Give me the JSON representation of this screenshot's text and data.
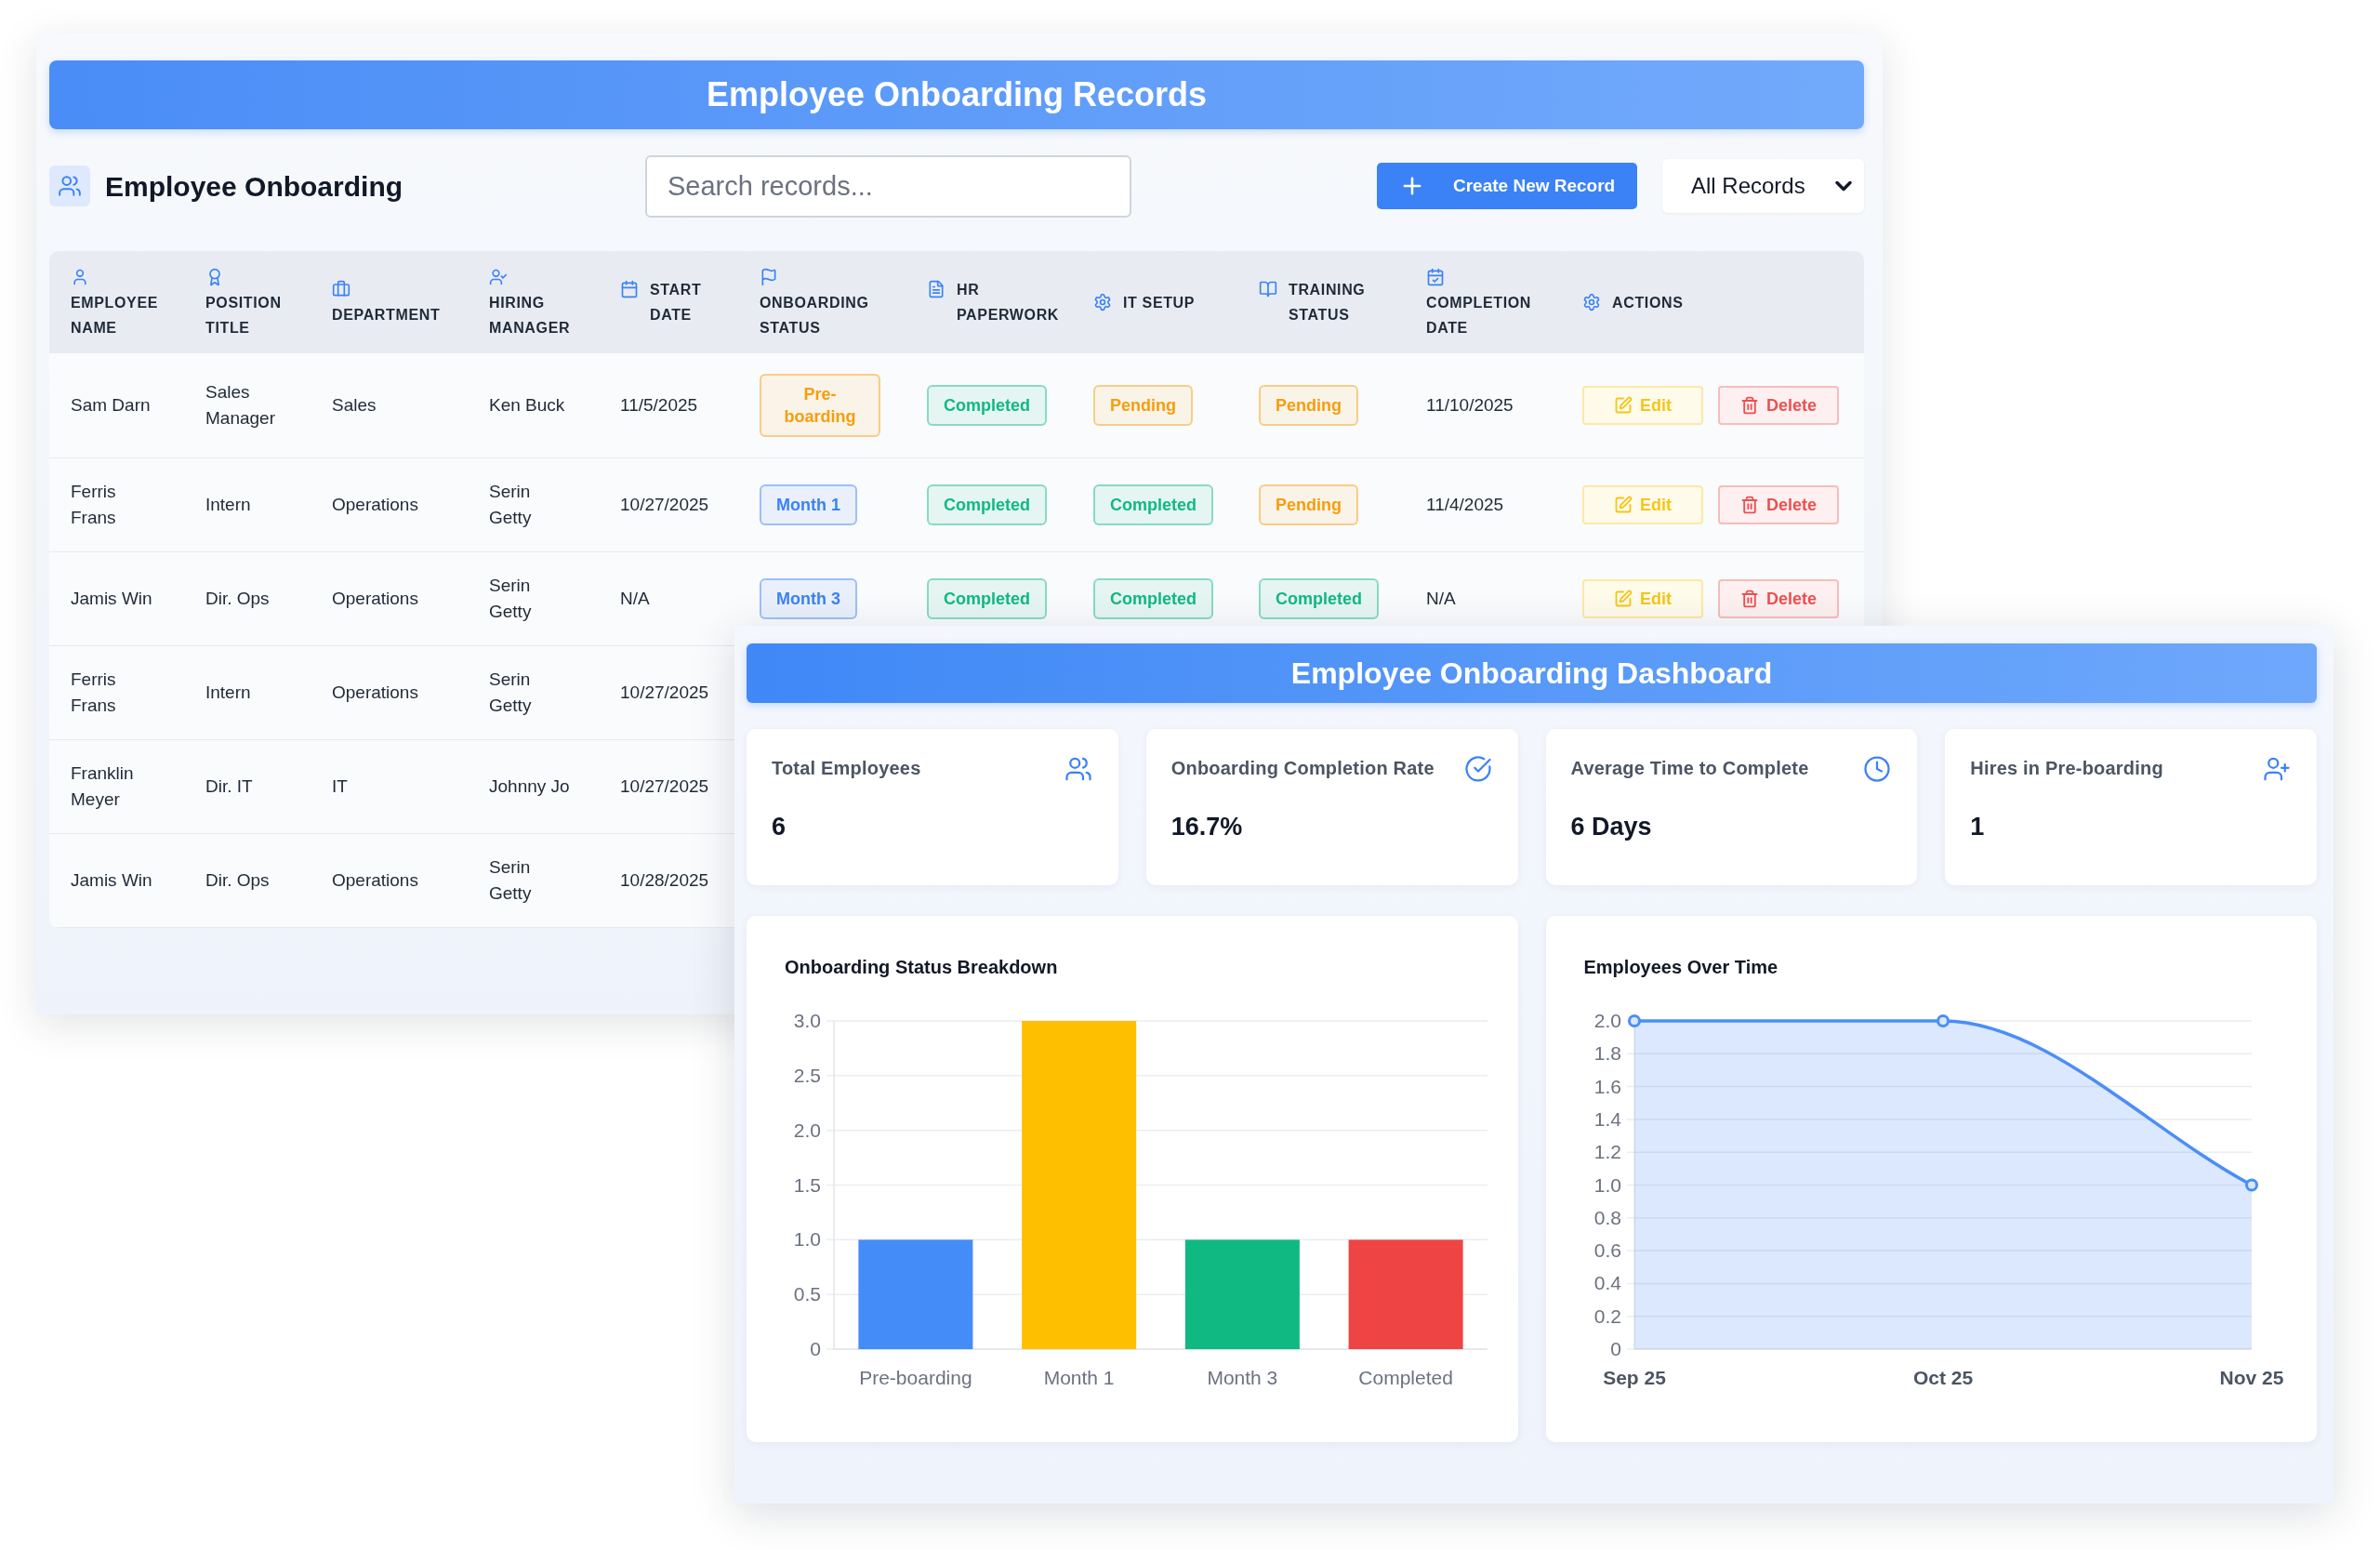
{
  "records_window": {
    "title": "Employee Onboarding Records",
    "heading": "Employee Onboarding",
    "search": {
      "placeholder": "Search records..."
    },
    "create_button": {
      "label": "Create New Record"
    },
    "filter": {
      "value": "All Records"
    },
    "table": {
      "columns": [
        {
          "label": "EMPLOYEE NAME"
        },
        {
          "label": "POSITION TITLE"
        },
        {
          "label": "DEPARTMENT"
        },
        {
          "label": "HIRING MANAGER"
        },
        {
          "label": "START DATE"
        },
        {
          "label": "ONBOARDING STATUS"
        },
        {
          "label": "HR PAPERWORK"
        },
        {
          "label": "IT SETUP"
        },
        {
          "label": "TRAINING STATUS"
        },
        {
          "label": "COMPLETION DATE"
        },
        {
          "label": "ACTIONS"
        }
      ],
      "rows": [
        {
          "cells": [
            {
              "kind": "text",
              "text": "Sam Darn"
            },
            {
              "kind": "text",
              "text": "Sales Manager"
            },
            {
              "kind": "text",
              "text": "Sales"
            },
            {
              "kind": "text",
              "text": "Ken Buck"
            },
            {
              "kind": "text",
              "text": "11/5/2025"
            },
            {
              "kind": "badge",
              "text": "Pre-boarding",
              "color": "#f59e0b"
            },
            {
              "kind": "badge",
              "text": "Completed",
              "color": "#10b981"
            },
            {
              "kind": "badge",
              "text": "Pending",
              "color": "#f59e0b"
            },
            {
              "kind": "badge",
              "text": "Pending",
              "color": "#f59e0b"
            },
            {
              "kind": "text",
              "text": "11/10/2025"
            },
            {
              "kind": "actions",
              "buttons": [
                {
                  "kind": "edit",
                  "label": "Edit"
                },
                {
                  "kind": "delete",
                  "label": "Delete"
                }
              ]
            }
          ]
        },
        {
          "cells": [
            {
              "kind": "text",
              "text": "Ferris Frans"
            },
            {
              "kind": "text",
              "text": "Intern"
            },
            {
              "kind": "text",
              "text": "Operations"
            },
            {
              "kind": "text",
              "text": "Serin Getty"
            },
            {
              "kind": "text",
              "text": "10/27/2025"
            },
            {
              "kind": "badge",
              "text": "Month 1",
              "color": "#3b82f6"
            },
            {
              "kind": "badge",
              "text": "Completed",
              "color": "#10b981"
            },
            {
              "kind": "badge",
              "text": "Completed",
              "color": "#10b981"
            },
            {
              "kind": "badge",
              "text": "Pending",
              "color": "#f59e0b"
            },
            {
              "kind": "text",
              "text": "11/4/2025"
            },
            {
              "kind": "actions",
              "buttons": [
                {
                  "kind": "edit",
                  "label": "Edit"
                },
                {
                  "kind": "delete",
                  "label": "Delete"
                }
              ]
            }
          ]
        },
        {
          "cells": [
            {
              "kind": "text",
              "text": "Jamis Win"
            },
            {
              "kind": "text",
              "text": "Dir. Ops"
            },
            {
              "kind": "text",
              "text": "Operations"
            },
            {
              "kind": "text",
              "text": "Serin Getty"
            },
            {
              "kind": "text",
              "text": "N/A"
            },
            {
              "kind": "badge",
              "text": "Month 3",
              "color": "#3b82f6"
            },
            {
              "kind": "badge",
              "text": "Completed",
              "color": "#10b981"
            },
            {
              "kind": "badge",
              "text": "Completed",
              "color": "#10b981"
            },
            {
              "kind": "badge",
              "text": "Completed",
              "color": "#10b981"
            },
            {
              "kind": "text",
              "text": "N/A"
            },
            {
              "kind": "actions",
              "buttons": [
                {
                  "kind": "edit",
                  "label": "Edit"
                },
                {
                  "kind": "delete",
                  "label": "Delete"
                }
              ]
            }
          ]
        },
        {
          "cells": [
            {
              "kind": "text",
              "text": "Ferris Frans"
            },
            {
              "kind": "text",
              "text": "Intern"
            },
            {
              "kind": "text",
              "text": "Operations"
            },
            {
              "kind": "text",
              "text": "Serin Getty"
            },
            {
              "kind": "text",
              "text": "10/27/2025"
            }
          ]
        },
        {
          "cells": [
            {
              "kind": "text",
              "text": "Franklin Meyer"
            },
            {
              "kind": "text",
              "text": "Dir. IT"
            },
            {
              "kind": "text",
              "text": "IT"
            },
            {
              "kind": "text",
              "text": "Johnny Jo"
            },
            {
              "kind": "text",
              "text": "10/27/2025"
            }
          ]
        },
        {
          "cells": [
            {
              "kind": "text",
              "text": "Jamis Win"
            },
            {
              "kind": "text",
              "text": "Dir. Ops"
            },
            {
              "kind": "text",
              "text": "Operations"
            },
            {
              "kind": "text",
              "text": "Serin Getty"
            },
            {
              "kind": "text",
              "text": "10/28/2025"
            }
          ]
        }
      ]
    }
  },
  "dashboard_window": {
    "title": "Employee Onboarding Dashboard",
    "stats": [
      {
        "label": "Total Employees",
        "value": "6"
      },
      {
        "label": "Onboarding Completion Rate",
        "value": "16.7%"
      },
      {
        "label": "Average Time to Complete",
        "value": "6 Days"
      },
      {
        "label": "Hires in Pre-boarding",
        "value": "1"
      }
    ],
    "charts": [
      {
        "chart_data": {
          "type": "bar",
          "title": "Onboarding Status Breakdown",
          "categories": [
            "Pre-boarding",
            "Month 1",
            "Month 3",
            "Completed"
          ],
          "values": [
            1,
            3,
            1,
            1
          ],
          "colors": [
            "#448cf8",
            "#fdbf00",
            "#10b981",
            "#ef4444"
          ],
          "ylim": [
            0,
            3
          ],
          "yticks": [
            0,
            0.5,
            {
              "value": 1,
              "label": "1.0"
            },
            1.5,
            {
              "value": 2,
              "label": "2.0"
            },
            2.5,
            {
              "value": 3,
              "label": "3.0"
            }
          ],
          "grid": true
        }
      },
      {
        "chart_data": {
          "type": "line",
          "title": "Employees Over Time",
          "categories": [
            "Sep 25",
            "Oct 25",
            "Nov 25"
          ],
          "series": [
            {
              "color": "#4a8ef8",
              "values": [
                2,
                2,
                1
              ],
              "marker": "circle"
            }
          ],
          "ylim": [
            0,
            2
          ],
          "yticks": [
            0,
            0.2,
            0.4,
            0.6,
            0.8,
            {
              "value": 1,
              "label": "1.0"
            },
            1.2,
            1.4,
            1.6,
            1.8,
            {
              "value": 2,
              "label": "2.0"
            }
          ],
          "grid": true
        }
      }
    ]
  }
}
